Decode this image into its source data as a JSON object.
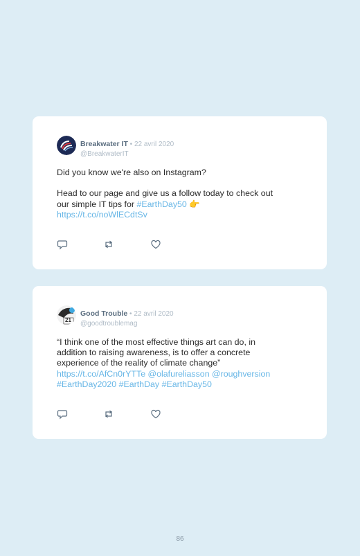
{
  "tweets": [
    {
      "author": "Breakwater IT",
      "separator": " • ",
      "date": "22 avril 2020",
      "handle": "@BreakwaterIT",
      "avatar_icon": "breakwater-logo",
      "text_line1": "Did you know we're also on Instagram?",
      "text_line2a": "Head to our page and give us a follow today to check out",
      "text_line2b": "our simple IT tips for ",
      "hashtag": "#EarthDay50",
      "emoji": "👉",
      "url": "https://t.co/noWlECdtSv",
      "actions": [
        "reply-icon",
        "retweet-icon",
        "like-icon"
      ]
    },
    {
      "author": "Good Trouble",
      "separator": " • ",
      "date": "22 avril 2020",
      "handle": "@goodtroublemag",
      "avatar_icon": "good-trouble-logo",
      "avatar_badge": "21",
      "text_line1": "“I think one of the most effective things art can do, in",
      "text_line2": "addition to raising awareness, is to offer a concrete",
      "text_line3": "experience of the reality of climate change”",
      "url": "https://t.co/AfCn0rYTTe",
      "mention1": "@olafureliasson",
      "mention2": "@roughversion",
      "hashtag1": "#EarthDay2020",
      "hashtag2": "#EarthDay",
      "hashtag3": "#EarthDay50",
      "actions": [
        "reply-icon",
        "retweet-icon",
        "like-icon"
      ]
    }
  ],
  "colors": {
    "background": "#ddedf5",
    "card": "#ffffff",
    "link": "#67b6e6",
    "name": "#5b6e80",
    "muted": "#b0bcc7"
  },
  "page_number": "86"
}
